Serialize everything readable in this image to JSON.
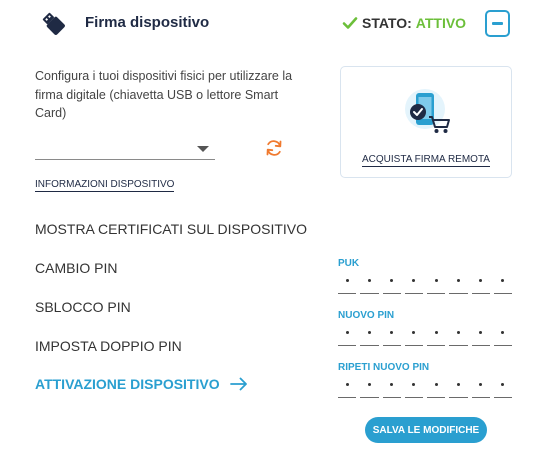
{
  "header": {
    "title": "Firma dispositivo",
    "icon": "usb-key-icon",
    "status_label": "STATO:",
    "status_value": "ATTIVO",
    "status_color": "#6cbf3a"
  },
  "description": "Configura i tuoi dispositivi fisici per utilizzare la firma digitale (chiavetta USB o lettore Smart Card)",
  "device_select": {
    "selected": ""
  },
  "info_link": "INFORMAZIONI DISPOSITIVO",
  "remote_card": {
    "label": "ACQUISTA FIRMA REMOTA",
    "icon": "smartphone-cart-icon"
  },
  "menu": {
    "items": [
      "MOSTRA CERTIFICATI SUL DISPOSITIVO",
      "CAMBIO PIN",
      "SBLOCCO PIN",
      "IMPOSTA DOPPIO PIN"
    ],
    "active": "ATTIVAZIONE DISPOSITIVO"
  },
  "pin_form": {
    "puk_label": "PUK",
    "new_pin_label": "NUOVO PIN",
    "repeat_pin_label": "RIPETI NUOVO PIN",
    "save_label": "SALVA LE MODIFICHE"
  },
  "colors": {
    "accent": "#2a9fd0",
    "dark": "#1f2a44",
    "refresh": "#f07a2f"
  }
}
